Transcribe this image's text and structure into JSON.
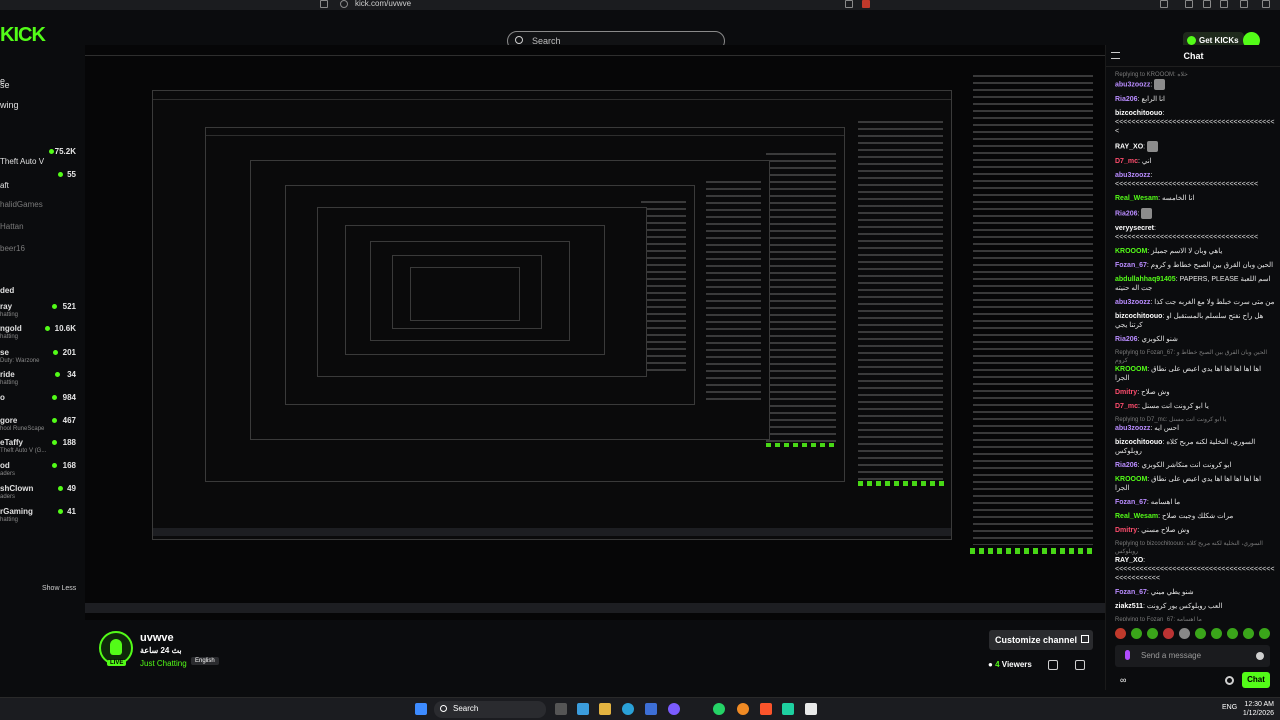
{
  "browser": {
    "url": "kick.com/uvwve"
  },
  "header": {
    "logo": "KICK",
    "search_placeholder": "Search",
    "get_kicks_label": "Get KICKs"
  },
  "sidebar": {
    "headings": [
      "e",
      "se",
      "wing"
    ],
    "recommended_heading": "ded",
    "items": [
      {
        "name": "Theft Auto V",
        "count": "75.2K"
      },
      {
        "name": "aft",
        "count": "55"
      },
      {
        "name": "halidGames",
        "count": ""
      },
      {
        "name": "Hattan",
        "count": ""
      },
      {
        "name": "beer16",
        "count": ""
      },
      {
        "name": "ray",
        "sub": "hatting",
        "count": "521"
      },
      {
        "name": "ngold",
        "sub": "hatting",
        "count": "10.6K"
      },
      {
        "name": "se",
        "sub": "Duty: Warzone",
        "count": "201"
      },
      {
        "name": "ride",
        "sub": "hatting",
        "count": "34"
      },
      {
        "name": "o",
        "sub": "",
        "count": "984"
      },
      {
        "name": "gore",
        "sub": "hool RuneScape",
        "count": "467"
      },
      {
        "name": "eTaffy",
        "sub": "Theft Auto V (G...",
        "count": "188"
      },
      {
        "name": "od",
        "sub": "aders",
        "count": "168"
      },
      {
        "name": "shClown",
        "sub": "aders",
        "count": "49"
      },
      {
        "name": "rGaming",
        "sub": "hatting",
        "count": "41"
      }
    ],
    "show_less": "Show Less"
  },
  "channel": {
    "name": "uvwve",
    "stream_title": "بث 24 ساعة",
    "category": "Just Chatting",
    "language": "English",
    "live_badge": "LIVE",
    "customize_label": "Customize channel",
    "viewer_count": "4",
    "viewers_label": "Viewers"
  },
  "chat": {
    "title": "Chat",
    "messages": [
      {
        "reply": "Replying to KROOOM: خلاه",
        "user": "abu3zoozz",
        "color": "#b98cff",
        "text": "",
        "emote": true
      },
      {
        "user": "Ria206",
        "color": "#b98cff",
        "text": "انا الرابع"
      },
      {
        "user": "bizcochitoouo",
        "color": "#ffffff",
        "text": "<<<<<<<<<<<<<<<<<<<<<<<<<<<<<<<<<<<<<<<<"
      },
      {
        "user": "RAY_XO",
        "color": "#ffffff",
        "text": "",
        "emote": true
      },
      {
        "user": "D7_mc",
        "color": "#ff4d6d",
        "text": "اني"
      },
      {
        "user": "abu3zoozz",
        "color": "#b98cff",
        "text": "<<<<<<<<<<<<<<<<<<<<<<<<<<<<<<<<<<<"
      },
      {
        "user": "Real_Wesam",
        "color": "#53fc18",
        "text": "انا الخامسه"
      },
      {
        "user": "Ria206",
        "color": "#b98cff",
        "text": "",
        "emote": true
      },
      {
        "user": "veryysecret",
        "color": "#ffffff",
        "text": "<<<<<<<<<<<<<<<<<<<<<<<<<<<<<<<<<<<"
      },
      {
        "user": "KROOOM",
        "color": "#53fc18",
        "text": "ياهي وبان لا الاسم جميلز"
      },
      {
        "user": "Fozan_67",
        "color": "#b98cff",
        "text": "الحين وبان القرق بين الصبح خطاط و كروم"
      },
      {
        "user": "abdullahhaq91405",
        "color": "#53fc18",
        "text": "PAPERS, PLEASE اسم اللعبة جت اله حنيته"
      },
      {
        "user": "abu3zoozz",
        "color": "#b98cff",
        "text": "من متى سرت خبلط ولا مع الغربه جت كذا"
      },
      {
        "user": "bizcochitoouo",
        "color": "#ffffff",
        "text": "هل راح نفتح سلسلم بالمستقبل او كرتنا يجي"
      },
      {
        "user": "Ria206",
        "color": "#b98cff",
        "text": "شنو الكوبزي"
      },
      {
        "reply": "Replying to Fozan_67: الحين وبان القرق بين الصبح خطاط و كروم",
        "user": "KROOOM",
        "color": "#53fc18",
        "text": "اها اها اها اها اها يدي اعيض على نطاق الجرا"
      },
      {
        "user": "Dmitry",
        "color": "#ff4d6d",
        "text": "وش صلاح"
      },
      {
        "user": "D7_mc",
        "color": "#ff4d6d",
        "text": "يا ابو كرونت انت مسنل"
      },
      {
        "reply": "Replying to D7_mc: يا ابو كرونت انت مسنل",
        "user": "abu3zoozz",
        "color": "#b98cff",
        "text": "احس ايه"
      },
      {
        "user": "bizcochitoouo",
        "color": "#ffffff",
        "text": "السوري، النخلية لكنه مربح كلاه روبلوكس"
      },
      {
        "user": "Ria206",
        "color": "#b98cff",
        "text": "ابو كرونت انت منكاشر الكوبزي"
      },
      {
        "user": "KROOOM",
        "color": "#53fc18",
        "text": "اها اها اها اها اها يدي اعيض على نطاق الجرا"
      },
      {
        "user": "Fozan_67",
        "color": "#b98cff",
        "text": "ما اهسامه"
      },
      {
        "user": "Real_Wesam",
        "color": "#53fc18",
        "text": "مرات شكلك وجبت صلاح"
      },
      {
        "user": "Dmitry",
        "color": "#ff4d6d",
        "text": "وش صلاح مسني"
      },
      {
        "reply": "Replying to bizcochitoouo: السوري، النخلية لكنه مربح كلاه روبلوكس",
        "user": "RAY_XO",
        "color": "#ffffff",
        "text": "<<<<<<<<<<<<<<<<<<<<<<<<<<<<<<<<<<<<<<<<<<<<<<<<<<"
      },
      {
        "user": "Fozan_67",
        "color": "#b98cff",
        "text": "شنو يطي ميني"
      },
      {
        "user": "ziakz511",
        "color": "#ffffff",
        "text": "العب روبلوكس يور كرونت"
      },
      {
        "reply": "Replying to Fozan_67: ما اهسامه",
        "user": "KROOOM",
        "color": "#53fc18",
        "text": "ابي واحد يقول لنا يجي ياله على"
      }
    ],
    "send_placeholder": "Send a message",
    "chat_button": "Chat"
  },
  "taskbar": {
    "search_label": "Search",
    "time": "12:30 AM",
    "date": "1/12/2026",
    "lang": "ENG"
  }
}
